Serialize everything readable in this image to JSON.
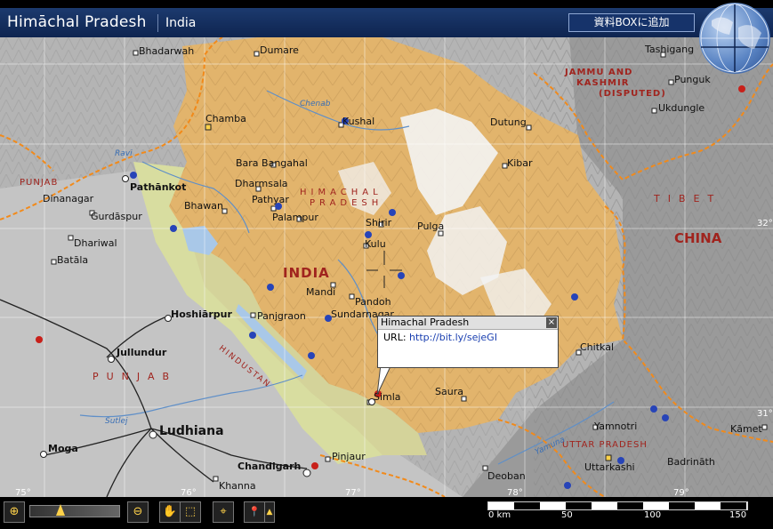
{
  "header": {
    "title": "Himāchal Pradesh",
    "subtitle": "India",
    "add_box_label": "資料BOXに追加"
  },
  "map_labels": {
    "bhadarwah": "Bhadarwah",
    "dumare": "Dumare",
    "tashigang": "Tashigang",
    "jk1": "JAMMU AND",
    "jk2": "KASHMIR",
    "jk3": "(DISPUTED)",
    "punguk": "Punguk",
    "ukdungle": "Ukdungle",
    "chamba": "Chamba",
    "chenab": "Chenab",
    "kushal": "Kushal",
    "dutung": "Dutung",
    "kibar": "Kibar",
    "ravi": "Ravi",
    "punjab_small": "PUNJAB",
    "dinanagar": "Dinanagar",
    "pathankot": "Pathānkot",
    "bara_bangahal": "Bara Bangahal",
    "dharmsala": "Dharmsala",
    "hp1": "HIMACHAL",
    "hp2": "PRADESH",
    "tibet": "TIBET",
    "gurdaspur": "Gurdāspur",
    "bhawan": "Bhawan",
    "pathyar": "Pathyar",
    "palampur": "Palampur",
    "shirir": "Shirir",
    "pulga": "Pulga",
    "china": "CHINA",
    "dhariwal": "Dhariwal",
    "kulu": "Kulu",
    "batala": "Batāla",
    "india": "INDIA",
    "mandi": "Mandi",
    "pandoh": "Pandoh",
    "hoshiarpur": "Hoshiārpur",
    "panjgraon": "Panjgraon",
    "sundarnagar": "Sundarnagar",
    "hindustan": "HINDUSTAN",
    "chitkal": "Chitkal",
    "jullundur": "Jullundur",
    "punjab_big": "PUNJAB",
    "simla": "Simla",
    "saura": "Saura",
    "sutlej": "Sutlej",
    "yamnotri": "Yamnotri",
    "kamet": "Kāmet",
    "ludhiana": "Ludhiana",
    "uttar_pradesh": "UTTAR PRADESH",
    "moga": "Moga",
    "pinjaur": "Pinjaur",
    "yamuna": "Yamuna",
    "uttarkashi": "Uttarkashi",
    "badrinath": "Badrināth",
    "chandigarh": "Chandigarh",
    "deoban": "Deoban",
    "khanna": "Khanna",
    "lon75": "75°",
    "lon76": "76°",
    "lon77": "77°",
    "lon78": "78°",
    "lon79": "79°",
    "lat32": "32°",
    "lat31": "31°"
  },
  "popup": {
    "title": "Himachal Pradesh",
    "url_label": "URL:",
    "url": "http://bit.ly/sejeGI",
    "close": "×"
  },
  "toolbar": {
    "zoom_in": "⊕",
    "zoom_out": "⊖",
    "pan": "✋",
    "select": "⬚",
    "target": "⌖",
    "pin": "📍",
    "zoom_level": 0.3
  },
  "scale": {
    "labels": [
      "0 km",
      "50",
      "100",
      "150"
    ]
  },
  "colors": {
    "himachal_fill": "#e2b46c",
    "himachal_dark": "#cf9648",
    "plains_fill": "#a6a6a6",
    "lowland_green": "#d6dc9e",
    "snow": "#f4f4f4",
    "border_orange": "#f28a1a",
    "lake": "#a9c8e8",
    "title_bar": "#163366"
  }
}
